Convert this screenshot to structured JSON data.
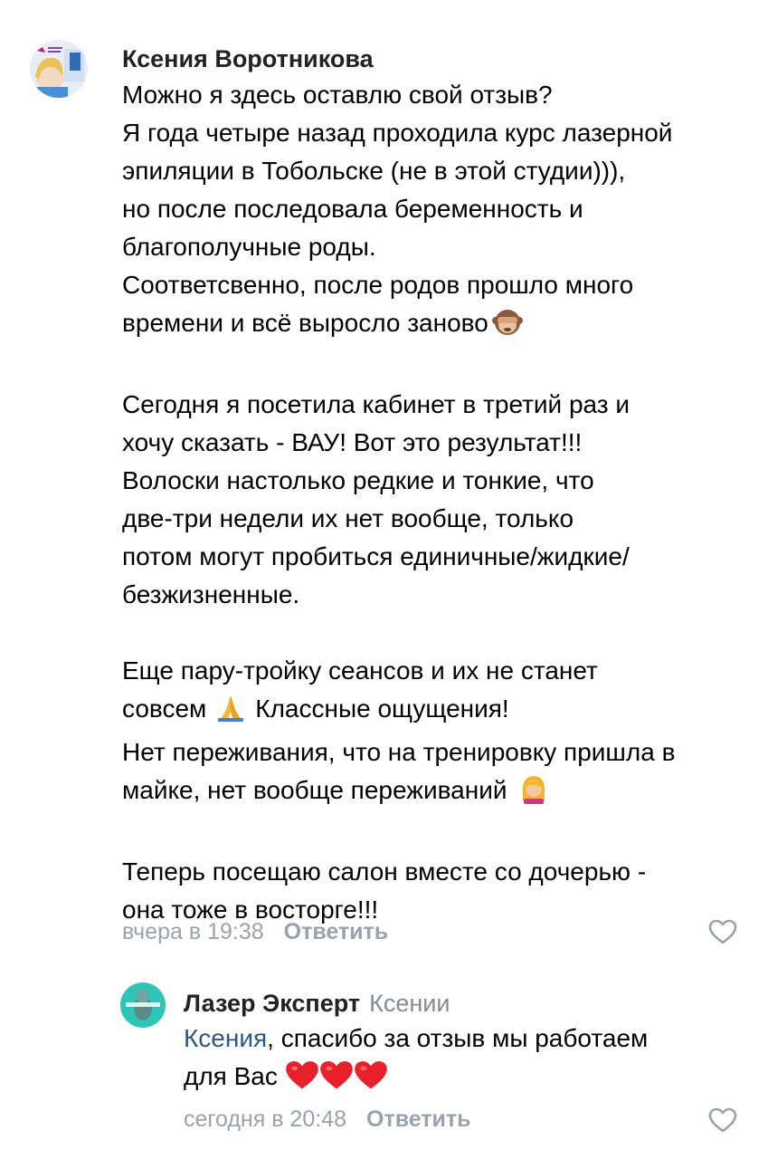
{
  "comments": [
    {
      "author": "Ксения Воротникова",
      "lines": [
        "Можно я здесь оставлю свой отзыв?",
        "Я года четыре назад проходила курс лазерной",
        "эпиляции в Тобольске (не в этой студии))),",
        "но после последовала беременность и",
        "благополучные роды.",
        "Соответсвенно, после родов прошло много",
        "времени и всё выросло заново",
        "",
        "Сегодня я посетила кабинет в третий раз и",
        "хочу сказать - ВАУ! Вот это результат!!!",
        "Волоски настолько редкие и тонкие, что",
        "две-три недели их нет вообще, только",
        "потом могут пробиться единичные/жидкие/",
        "безжизненные.",
        "",
        "Еще пару-тройку сеансов и их не станет",
        "совсем",
        "Классные ощущения!",
        "Нет переживания, что на тренировку пришла в",
        "майке, нет вообще переживаний",
        "",
        "Теперь посещаю салон вместе со дочерью -",
        "она тоже в восторге!!!"
      ],
      "time": "вчера в 19:38",
      "reply_label": "Ответить"
    },
    {
      "author": "Лазер Эксперт",
      "reply_to": "Ксении",
      "mention": "Ксения",
      "line1_rest": ", спасибо за отзыв мы работаем",
      "line2": "для Вас",
      "time": "сегодня в 20:48",
      "reply_label": "Ответить"
    }
  ],
  "icons": {
    "emoji_1": "see-no-evil-monkey",
    "emoji_2": "folded-hands",
    "emoji_3": "woman-facepalming",
    "emoji_hearts": "red-heart",
    "like": "heart-outline"
  },
  "colors": {
    "link": "#2a5885",
    "meta": "#99a2ad",
    "reply_to": "#818c99",
    "heart": "#e8202a"
  }
}
